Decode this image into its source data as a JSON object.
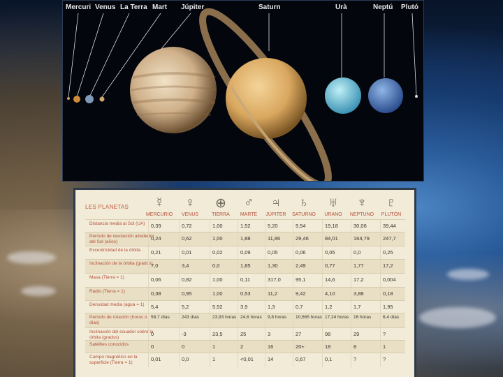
{
  "planets_image": {
    "labels": [
      "Mercuri",
      "Venus",
      "La Terra",
      "Mart",
      "Júpiter",
      "Saturn",
      "Urà",
      "Neptú",
      "Plutó"
    ]
  },
  "table": {
    "title": "LES PLANETAS",
    "symbols": [
      "☿",
      "♀",
      "⊕",
      "♂",
      "♃",
      "♄",
      "♅",
      "♆",
      "♇"
    ],
    "columns": [
      "MERCURIO",
      "VENUS",
      "TIERRA",
      "MARTE",
      "JÚPITER",
      "SATURNO",
      "URANO",
      "NEPTUNO",
      "PLUTÓN"
    ],
    "rows": [
      {
        "label": "Distancia media al Sol (UA)",
        "values": [
          "0,39",
          "0,72",
          "1,00",
          "1,52",
          "5,20",
          "9,54",
          "19,18",
          "30,06",
          "39,44"
        ]
      },
      {
        "label": "Período de revolución alrededor del Sol (años)",
        "values": [
          "0,24",
          "0,62",
          "1,00",
          "1,88",
          "11,86",
          "29,46",
          "84,01",
          "164,79",
          "247,7"
        ]
      },
      {
        "label": "Excentricidad de la órbita",
        "values": [
          "0,21",
          "0,01",
          "0,02",
          "0,09",
          "0,05",
          "0,06",
          "0,05",
          "0,0",
          "0,25"
        ]
      },
      {
        "label": "Inclinación de la órbita (grados)",
        "values": [
          "7,0",
          "3,4",
          "0,0",
          "1,85",
          "1,30",
          "2,49",
          "0,77",
          "1,77",
          "17,2"
        ]
      },
      {
        "label": "Masa (Tierra = 1)",
        "values": [
          "0,06",
          "0,82",
          "1,00",
          "0,11",
          "317,0",
          "95,1",
          "14,6",
          "17,2",
          "0,004"
        ]
      },
      {
        "label": "Radio (Tierra = 1)",
        "values": [
          "0,38",
          "0,95",
          "1,00",
          "0,53",
          "11,2",
          "9,42",
          "4,10",
          "3,88",
          "0,18"
        ]
      },
      {
        "label": "Densidad media (agua = 1)",
        "values": [
          "5,4",
          "5,2",
          "5,52",
          "3,9",
          "1,3",
          "0,7",
          "1,2",
          "1,7",
          "1,95"
        ]
      },
      {
        "label": "Período de rotación (horas o días)",
        "values": [
          "58,7 días",
          "243 días",
          "23,93 horas",
          "24,6 horas",
          "9,8 horas",
          "10,565 horas",
          "17,24 horas",
          "16 horas",
          "6,4 días"
        ]
      },
      {
        "label": "Inclinación del ecuador sobre la órbita (grados)",
        "values": [
          "0",
          "-3",
          "23,5",
          "25",
          "3",
          "27",
          "98",
          "29",
          "?"
        ]
      },
      {
        "label": "Satélites conocidos",
        "values": [
          "0",
          "0",
          "1",
          "2",
          "16",
          "20+",
          "18",
          "8",
          "1"
        ]
      },
      {
        "label": "Campo magnético en la superficie (Tierra = 1)",
        "values": [
          "0,01",
          "0,0",
          "1",
          "<0,01",
          "14",
          "0,67",
          "0,1",
          "?",
          "?"
        ]
      }
    ]
  }
}
